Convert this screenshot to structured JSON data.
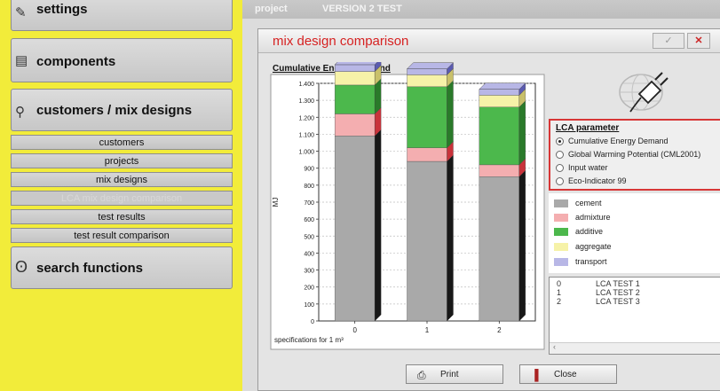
{
  "colors": {
    "sidebar_bg": "#f2ec3a",
    "title_red": "#d62222",
    "cement": "#a9a9a9",
    "admixture": "#f4aeb0",
    "additive": "#4cb84c",
    "aggregate": "#f6f2a8",
    "transport": "#b8b7e6"
  },
  "sidebar": {
    "main_items": [
      {
        "label": "settings",
        "icon": "pencil-icon"
      },
      {
        "label": "components",
        "icon": "document-icon"
      },
      {
        "label": "customers / mix designs",
        "icon": "link-icon"
      },
      {
        "label": "search functions",
        "icon": "magnifier-icon"
      }
    ],
    "sub_items": [
      "customers",
      "projects",
      "mix designs",
      "LCA mix design comparison",
      "test results",
      "test result comparison"
    ]
  },
  "topbar": {
    "project_label": "project",
    "project_value": "VERSION 2 TEST"
  },
  "dialog": {
    "title": "mix design comparison",
    "check_label": "✓",
    "close_label": "✕",
    "lca_title": "LCA parameter",
    "lca_options": [
      {
        "label": "Cumulative Energy Demand",
        "selected": true
      },
      {
        "label": "Global Warming Potential (CML2001)",
        "selected": false
      },
      {
        "label": "Input water",
        "selected": false
      },
      {
        "label": "Eco-Indicator 99",
        "selected": false
      }
    ],
    "legend": [
      {
        "label": "cement",
        "color": "#a9a9a9"
      },
      {
        "label": "admixture",
        "color": "#f4aeb0"
      },
      {
        "label": "additive",
        "color": "#4cb84c"
      },
      {
        "label": "aggregate",
        "color": "#f6f2a8"
      },
      {
        "label": "transport",
        "color": "#b8b7e6"
      }
    ],
    "list": [
      {
        "id": "0",
        "name": "LCA TEST 1"
      },
      {
        "id": "1",
        "name": "LCA TEST 2"
      },
      {
        "id": "2",
        "name": "LCA TEST 3"
      }
    ],
    "print_label": "Print",
    "close_button_label": "Close",
    "plug_icon": "plug-globe-icon"
  },
  "chart_data": {
    "type": "bar",
    "title": "Cumulative Energy Demand",
    "ylabel": "MJ",
    "xlabel": "specifications for 1 m³",
    "categories": [
      "0",
      "1",
      "2"
    ],
    "ylim": [
      0,
      1400
    ],
    "yticks": [
      0,
      100,
      200,
      300,
      400,
      500,
      600,
      700,
      800,
      900,
      1000,
      1100,
      1200,
      1300,
      1400
    ],
    "ytick_labels": [
      "0",
      "100",
      "200",
      "300",
      "400",
      "500",
      "600",
      "700",
      "800",
      "900",
      "1.000",
      "1.100",
      "1.200",
      "1.300",
      "1.400"
    ],
    "series": [
      {
        "name": "cement",
        "values": [
          1090,
          940,
          850
        ]
      },
      {
        "name": "admixture",
        "values": [
          130,
          80,
          70
        ]
      },
      {
        "name": "additive",
        "values": [
          170,
          360,
          340
        ]
      },
      {
        "name": "aggregate",
        "values": [
          80,
          70,
          70
        ]
      },
      {
        "name": "transport",
        "values": [
          40,
          35,
          35
        ]
      }
    ],
    "grid": true,
    "stacked": true
  }
}
